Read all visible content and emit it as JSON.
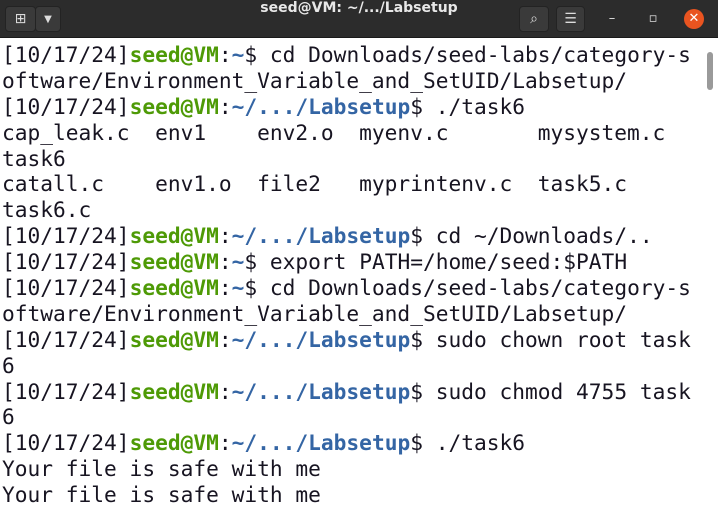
{
  "window": {
    "title": "seed@VM: ~/.../Labsetup",
    "icons": {
      "new_tab": "new-tab-icon",
      "menu": "chevron-down-icon",
      "search": "search-icon",
      "hamburger": "hamburger-menu-icon",
      "minimize": "minimize-icon",
      "maximize": "maximize-icon",
      "close": "close-icon"
    }
  },
  "colors": {
    "user": "#4e9a06",
    "path": "#3465a4",
    "close": "#e95420"
  },
  "lines": [
    {
      "date": "[10/17/24]",
      "user": "seed@VM",
      "sep": ":",
      "path": "~",
      "cmd": "$ cd Downloads/seed-labs/category-s"
    },
    {
      "text": "oftware/Environment_Variable_and_SetUID/Labsetup/"
    },
    {
      "date": "[10/17/24]",
      "user": "seed@VM",
      "sep": ":",
      "path": "~/.../Labsetup",
      "cmd": "$ ./task6"
    },
    {
      "text": "cap_leak.c  env1    env2.o  myenv.c       mysystem.c"
    },
    {
      "text": "task6"
    },
    {
      "text": "catall.c    env1.o  file2   myprintenv.c  task5.c"
    },
    {
      "text": "task6.c"
    },
    {
      "date": "[10/17/24]",
      "user": "seed@VM",
      "sep": ":",
      "path": "~/.../Labsetup",
      "cmd": "$ cd ~/Downloads/.."
    },
    {
      "date": "[10/17/24]",
      "user": "seed@VM",
      "sep": ":",
      "path": "~",
      "cmd": "$ export PATH=/home/seed:$PATH"
    },
    {
      "date": "[10/17/24]",
      "user": "seed@VM",
      "sep": ":",
      "path": "~",
      "cmd": "$ cd Downloads/seed-labs/category-s"
    },
    {
      "text": "oftware/Environment_Variable_and_SetUID/Labsetup/"
    },
    {
      "date": "[10/17/24]",
      "user": "seed@VM",
      "sep": ":",
      "path": "~/.../Labsetup",
      "cmd": "$ sudo chown root task"
    },
    {
      "text": "6"
    },
    {
      "date": "[10/17/24]",
      "user": "seed@VM",
      "sep": ":",
      "path": "~/.../Labsetup",
      "cmd": "$ sudo chmod 4755 task"
    },
    {
      "text": "6"
    },
    {
      "date": "[10/17/24]",
      "user": "seed@VM",
      "sep": ":",
      "path": "~/.../Labsetup",
      "cmd": "$ ./task6"
    },
    {
      "text": "Your file is safe with me"
    },
    {
      "text": "Your file is safe with me"
    }
  ]
}
